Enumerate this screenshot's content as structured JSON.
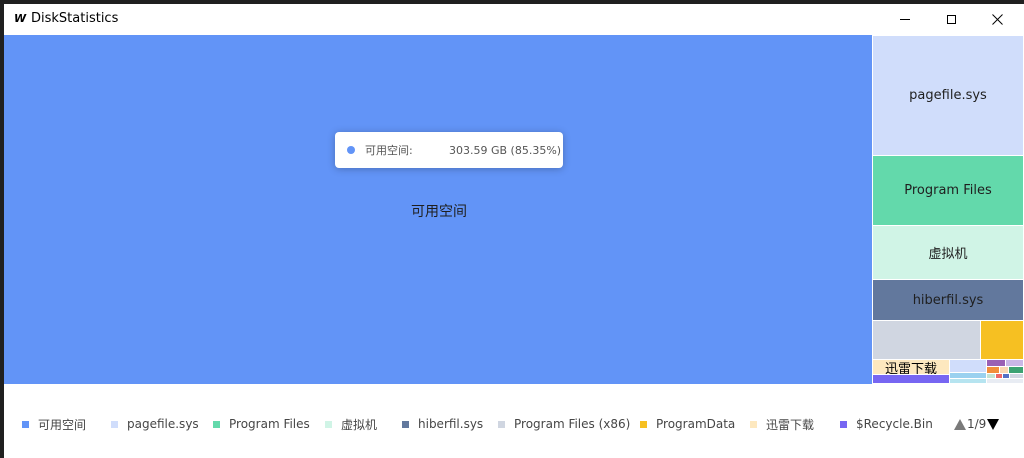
{
  "window": {
    "app_icon": "W",
    "title": "DiskStatistics"
  },
  "tooltip": {
    "name": "可用空间:",
    "value": "303.59 GB (85.35%)",
    "color": "#6294f7"
  },
  "treemap": {
    "items": [
      {
        "name": "可用空间",
        "label": "可用空间",
        "color": "#6294f7"
      },
      {
        "name": "pagefile.sys",
        "label": "pagefile.sys",
        "color": "#d0ddfb"
      },
      {
        "name": "Program Files",
        "label": "Program Files",
        "color": "#63d9ab"
      },
      {
        "name": "虚拟机",
        "label": "虚拟机",
        "color": "#d0f4e6"
      },
      {
        "name": "hiberfil.sys",
        "label": "hiberfil.sys",
        "color": "#62789d"
      },
      {
        "name": "Program Files (x86)",
        "label": "",
        "color": "#d0d6e1"
      },
      {
        "name": "ProgramData",
        "label": "",
        "color": "#f6c022"
      },
      {
        "name": "迅雷下载",
        "label": "迅雷下载",
        "color": "#fde8bf"
      },
      {
        "name": "$Recycle.Bin",
        "label": "",
        "color": "#7766f2"
      }
    ]
  },
  "legend": {
    "items": [
      {
        "label": "可用空间",
        "color": "#6294f7"
      },
      {
        "label": "pagefile.sys",
        "color": "#d0ddfb"
      },
      {
        "label": "Program Files",
        "color": "#63d9ab"
      },
      {
        "label": "虚拟机",
        "color": "#d0f4e6"
      },
      {
        "label": "hiberfil.sys",
        "color": "#62789d"
      },
      {
        "label": "Program Files (x86)",
        "color": "#d0d6e1"
      },
      {
        "label": "ProgramData",
        "color": "#f6c022"
      },
      {
        "label": "迅雷下载",
        "color": "#fde8bf"
      },
      {
        "label": "$Recycle.Bin",
        "color": "#7766f2"
      }
    ],
    "page": "1/9"
  }
}
